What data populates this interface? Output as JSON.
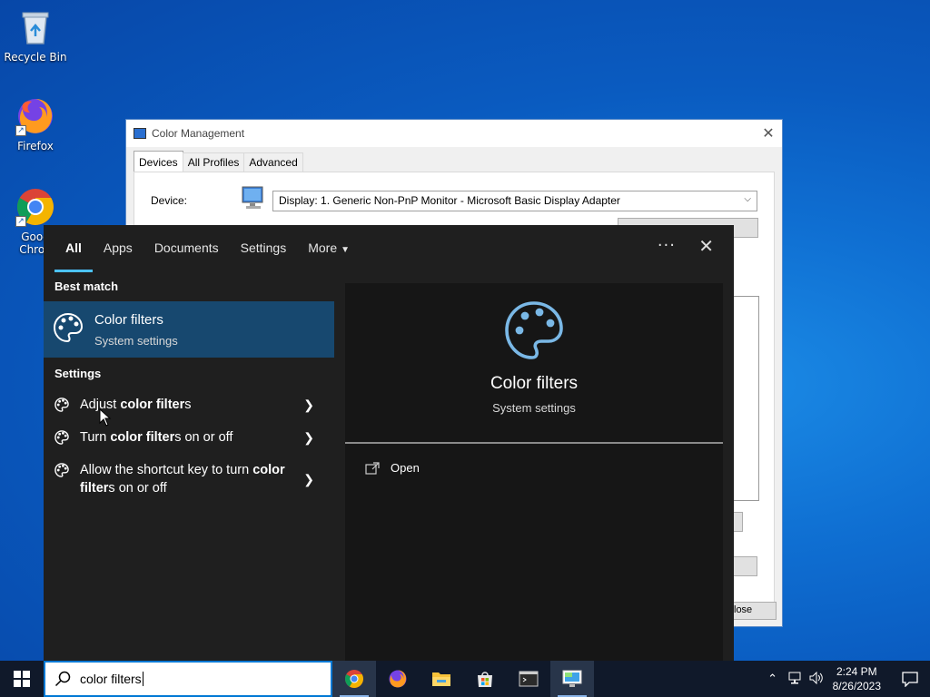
{
  "desktop": {
    "icons": [
      {
        "label": "Recycle Bin"
      },
      {
        "label": "Firefox"
      },
      {
        "label": "Google Chrome",
        "label_line1": "Goog",
        "label_line2": "Chron"
      }
    ]
  },
  "color_management": {
    "title": "Color Management",
    "tabs": [
      "Devices",
      "All Profiles",
      "Advanced"
    ],
    "device_label": "Device:",
    "device_value": "Display: 1. Generic Non-PnP Monitor - Microsoft Basic Display Adapter",
    "close_button": "lose"
  },
  "search": {
    "tabs": [
      "All",
      "Apps",
      "Documents",
      "Settings",
      "More"
    ],
    "best_match_label": "Best match",
    "best_match": {
      "title": "Color filters",
      "subtitle": "System settings"
    },
    "settings_label": "Settings",
    "settings_items": [
      {
        "pre": "Adjust ",
        "bold": "color filter",
        "post": "s"
      },
      {
        "pre": "Turn ",
        "bold": "color filter",
        "post": "s on or off"
      },
      {
        "pre": "Allow the shortcut key to turn ",
        "bold": "color filter",
        "post": "s on or off"
      }
    ],
    "preview": {
      "title": "Color filters",
      "subtitle": "System settings",
      "action_open": "Open"
    },
    "query": "color filters"
  },
  "taskbar": {
    "clock_time": "2:24 PM",
    "clock_date": "8/26/2023"
  },
  "colors": {
    "accent": "#4cc2ff",
    "best_match_bg": "#17486f",
    "flyout_bg": "#1f1f1f",
    "taskbar_bg": "#10192a"
  }
}
